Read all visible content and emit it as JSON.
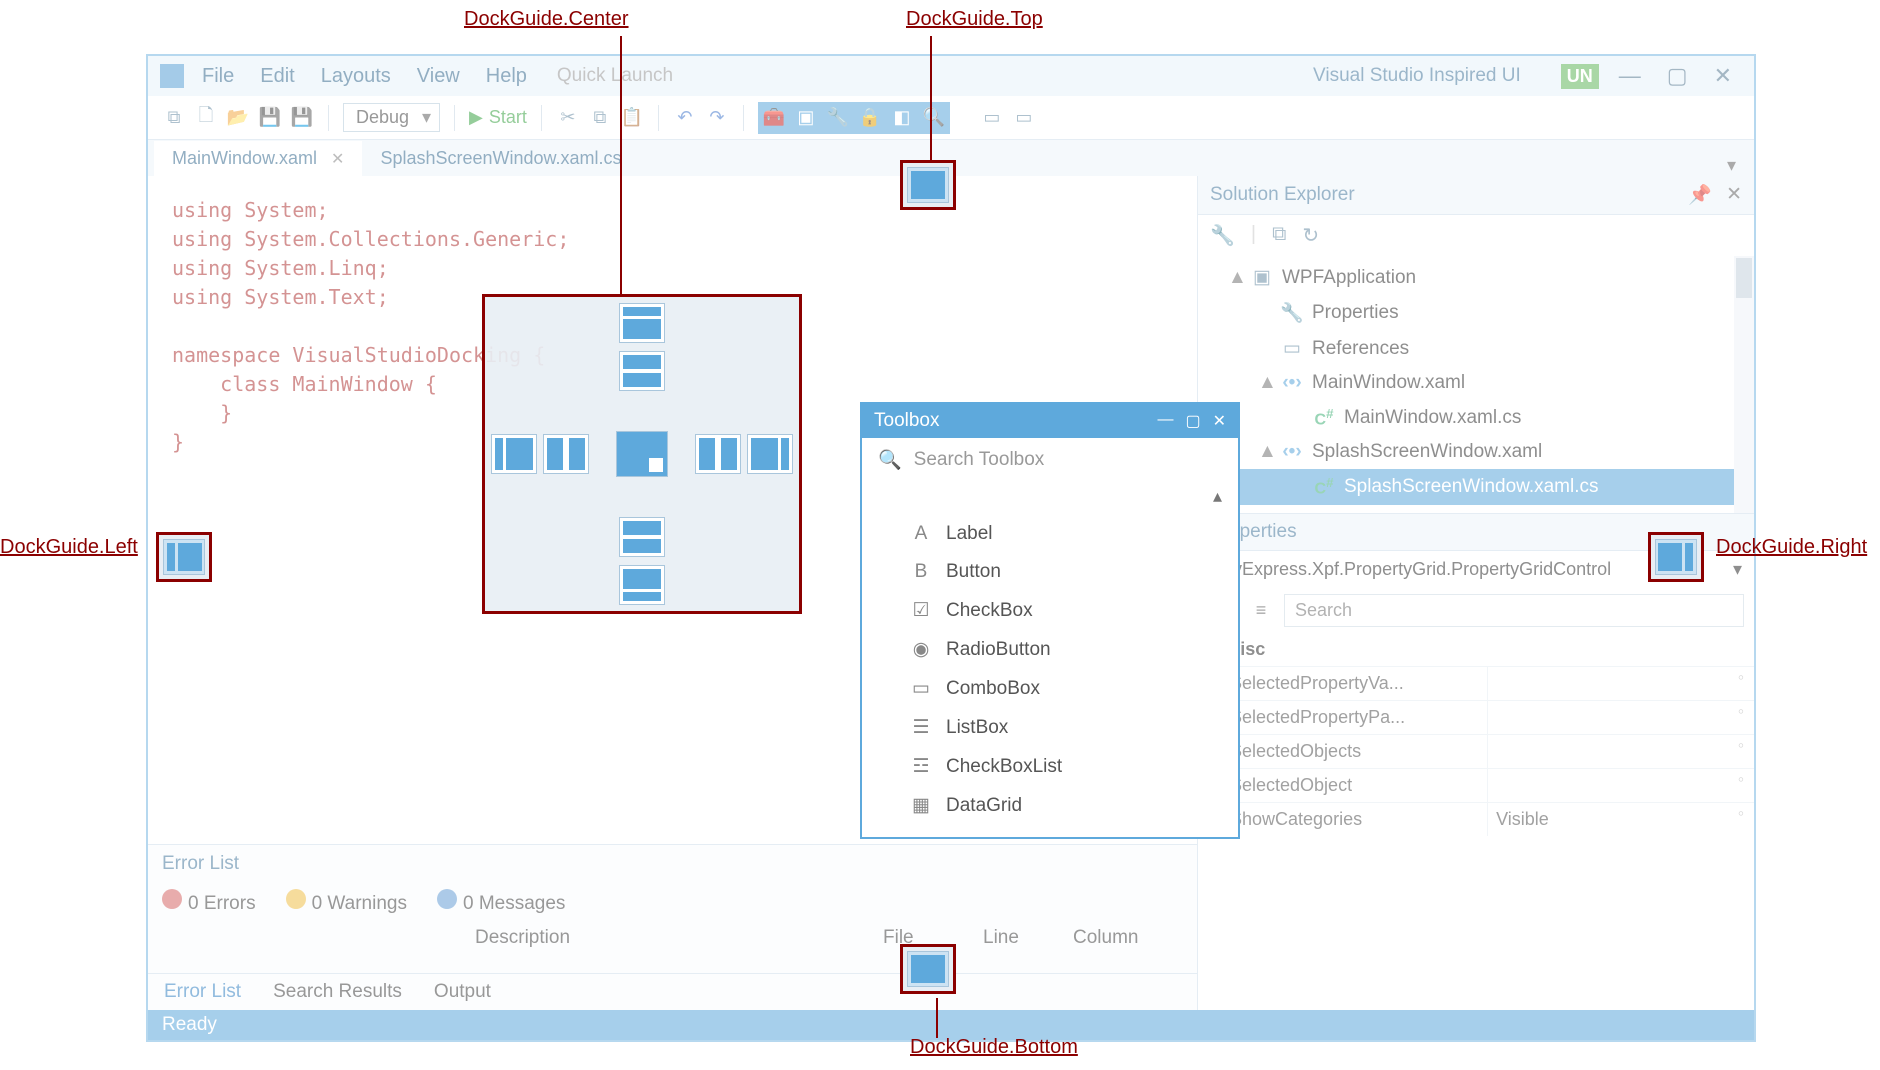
{
  "menus": [
    "File",
    "Edit",
    "Layouts",
    "View",
    "Help"
  ],
  "quicklaunch_placeholder": "Quick Launch",
  "window_title": "Visual Studio Inspired UI",
  "user_badge": "UN",
  "toolbar": {
    "config": "Debug",
    "start": "Start"
  },
  "doc_tabs": [
    {
      "label": "MainWindow.xaml",
      "active": true,
      "closeable": true
    },
    {
      "label": "SplashScreenWindow.xaml.cs",
      "active": false,
      "closeable": false
    }
  ],
  "code": "using System;\nusing System.Collections.Generic;\nusing System.Linq;\nusing System.Text;\n\nnamespace VisualStudioDocking {\n    class MainWindow {\n    }\n}",
  "error_list": {
    "title": "Error List",
    "errors": "0 Errors",
    "warnings": "0 Warnings",
    "messages": "0 Messages",
    "columns": [
      "Description",
      "File",
      "Line",
      "Column"
    ],
    "tabs": [
      "Error List",
      "Search Results",
      "Output"
    ],
    "active_tab": "Error List"
  },
  "solution_explorer": {
    "title": "Solution Explorer",
    "tree": [
      {
        "level": 1,
        "exp": "▲",
        "icon": "app",
        "label": "WPFApplication"
      },
      {
        "level": 2,
        "exp": "",
        "icon": "wrench",
        "label": "Properties"
      },
      {
        "level": 2,
        "exp": "",
        "icon": "ref",
        "label": "References"
      },
      {
        "level": 2,
        "exp": "▲",
        "icon": "xaml",
        "label": "MainWindow.xaml"
      },
      {
        "level": 3,
        "exp": "",
        "icon": "cs",
        "label": "MainWindow.xaml.cs"
      },
      {
        "level": 2,
        "exp": "▲",
        "icon": "xaml",
        "label": "SplashScreenWindow.xaml"
      },
      {
        "level": 3,
        "exp": "",
        "icon": "cs",
        "label": "SplashScreenWindow.xaml.cs",
        "selected": true
      }
    ]
  },
  "properties": {
    "title": "Properties",
    "type": "DevExpress.Xpf.PropertyGrid.PropertyGridControl",
    "search_placeholder": "Search",
    "category": "Misc",
    "rows": [
      {
        "name": "SelectedPropertyVa...",
        "value": ""
      },
      {
        "name": "SelectedPropertyPa...",
        "value": ""
      },
      {
        "name": "SelectedObjects",
        "value": ""
      },
      {
        "name": "SelectedObject",
        "value": ""
      },
      {
        "name": "ShowCategories",
        "value": "Visible"
      }
    ]
  },
  "toolbox": {
    "title": "Toolbox",
    "search_placeholder": "Search Toolbox",
    "items": [
      {
        "icon": "A",
        "label": "Label"
      },
      {
        "icon": "B",
        "label": "Button"
      },
      {
        "icon": "☑",
        "label": "CheckBox"
      },
      {
        "icon": "◉",
        "label": "RadioButton"
      },
      {
        "icon": "▭",
        "label": "ComboBox"
      },
      {
        "icon": "☰",
        "label": "ListBox"
      },
      {
        "icon": "☲",
        "label": "CheckBoxList"
      },
      {
        "icon": "▦",
        "label": "DataGrid"
      }
    ]
  },
  "statusbar": "Ready",
  "callouts": {
    "center": "DockGuide.Center",
    "top": "DockGuide.Top",
    "left": "DockGuide.Left",
    "right": "DockGuide.Right",
    "bottom": "DockGuide.Bottom"
  }
}
